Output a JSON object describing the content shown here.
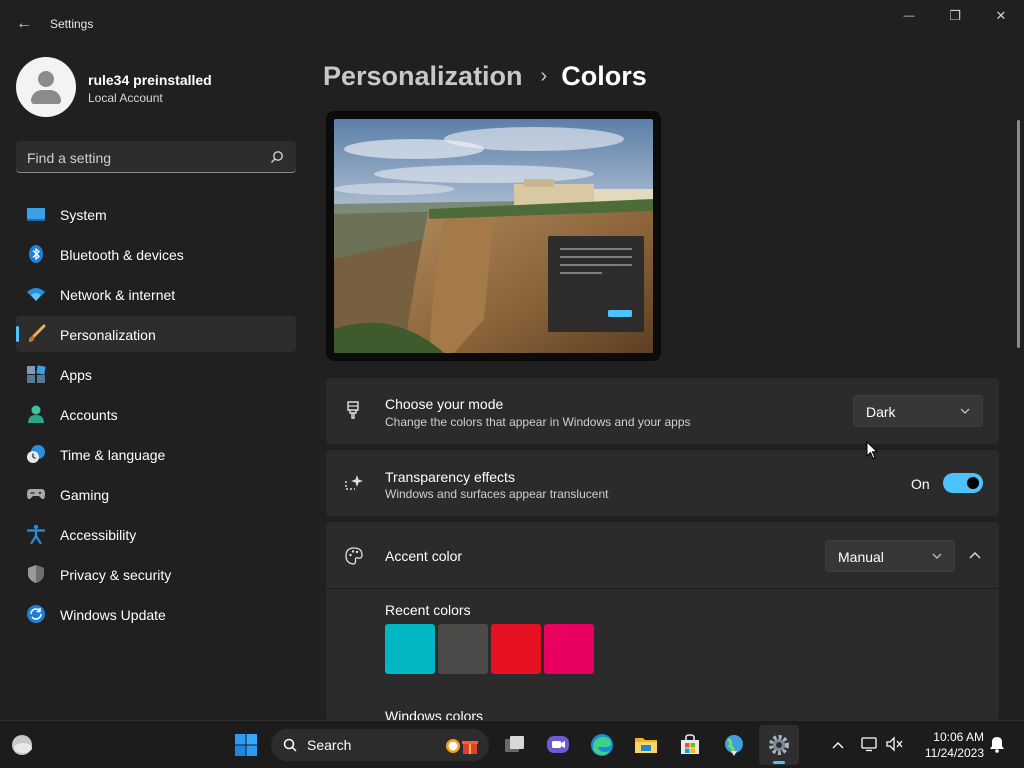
{
  "window": {
    "title": "Settings",
    "back_symbol": "←",
    "minimize_symbol": "—",
    "restore_symbol": "❐",
    "close_symbol": "✕"
  },
  "user": {
    "name": "rule34 preinstalled",
    "account_type": "Local Account"
  },
  "search": {
    "placeholder": "Find a setting"
  },
  "sidebar": {
    "items": [
      {
        "label": "System",
        "icon": "system-icon"
      },
      {
        "label": "Bluetooth & devices",
        "icon": "bluetooth-icon"
      },
      {
        "label": "Network & internet",
        "icon": "wifi-icon"
      },
      {
        "label": "Personalization",
        "icon": "brush-icon",
        "active": true
      },
      {
        "label": "Apps",
        "icon": "apps-icon"
      },
      {
        "label": "Accounts",
        "icon": "accounts-icon"
      },
      {
        "label": "Time & language",
        "icon": "time-language-icon"
      },
      {
        "label": "Gaming",
        "icon": "gaming-icon"
      },
      {
        "label": "Accessibility",
        "icon": "accessibility-icon"
      },
      {
        "label": "Privacy & security",
        "icon": "shield-icon"
      },
      {
        "label": "Windows Update",
        "icon": "update-icon"
      }
    ]
  },
  "breadcrumb": {
    "parent": "Personalization",
    "separator": "›",
    "current": "Colors"
  },
  "mode": {
    "title": "Choose your mode",
    "subtitle": "Change the colors that appear in Windows and your apps",
    "value": "Dark"
  },
  "transparency": {
    "title": "Transparency effects",
    "subtitle": "Windows and surfaces appear translucent",
    "state_label": "On",
    "enabled": true
  },
  "accent": {
    "title": "Accent color",
    "value": "Manual",
    "recent_label": "Recent colors",
    "recent_colors": [
      "#00b7c3",
      "#4c4a48",
      "#e81123",
      "#ea005e"
    ],
    "windows_colors_label": "Windows colors"
  },
  "taskbar": {
    "search_label": "Search",
    "time": "10:06 AM",
    "date": "11/24/2023"
  },
  "colors": {
    "accent": "#4cc2ff",
    "background": "#202020",
    "card": "#2b2b2b"
  }
}
